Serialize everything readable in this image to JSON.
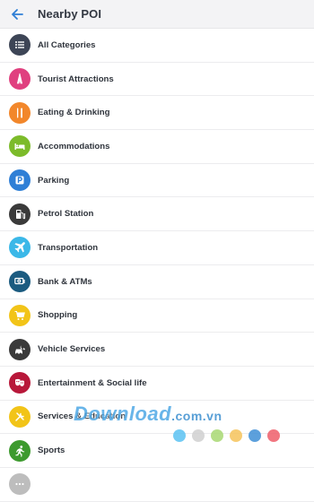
{
  "header": {
    "title": "Nearby POI",
    "back_icon": "arrow-left-icon"
  },
  "colors": {
    "accent": "#2f7fd6"
  },
  "categories": [
    {
      "label": "All Categories",
      "icon": "list-icon",
      "color": "#3d4556"
    },
    {
      "label": "Tourist Attractions",
      "icon": "landmark-icon",
      "color": "#e0407f"
    },
    {
      "label": "Eating & Drinking",
      "icon": "fork-knife-icon",
      "color": "#f2872b"
    },
    {
      "label": "Accommodations",
      "icon": "bed-icon",
      "color": "#7cbb2a"
    },
    {
      "label": "Parking",
      "icon": "parking-icon",
      "color": "#2f7fd6"
    },
    {
      "label": "Petrol Station",
      "icon": "fuel-pump-icon",
      "color": "#3a3a3a"
    },
    {
      "label": "Transportation",
      "icon": "airplane-icon",
      "color": "#3bb8e8"
    },
    {
      "label": "Bank & ATMs",
      "icon": "money-icon",
      "color": "#1b5b80"
    },
    {
      "label": "Shopping",
      "icon": "cart-icon",
      "color": "#f2c418"
    },
    {
      "label": "Vehicle Services",
      "icon": "car-wrench-icon",
      "color": "#3a3a3a"
    },
    {
      "label": "Entertainment & Social life",
      "icon": "masks-icon",
      "color": "#b8183a"
    },
    {
      "label": "Services & Education",
      "icon": "tools-icon",
      "color": "#f2c418"
    },
    {
      "label": "Sports",
      "icon": "runner-icon",
      "color": "#3d9a2e"
    },
    {
      "label": "",
      "icon": "more-icon",
      "color": "#bdbdbd"
    }
  ],
  "watermark": {
    "text": "Download",
    "suffix": ".com.vn",
    "dot_colors": [
      "#5bc2f2",
      "#d0d0d0",
      "#a8d872",
      "#f6c35a",
      "#3f8fd6",
      "#ee5e6a"
    ]
  }
}
